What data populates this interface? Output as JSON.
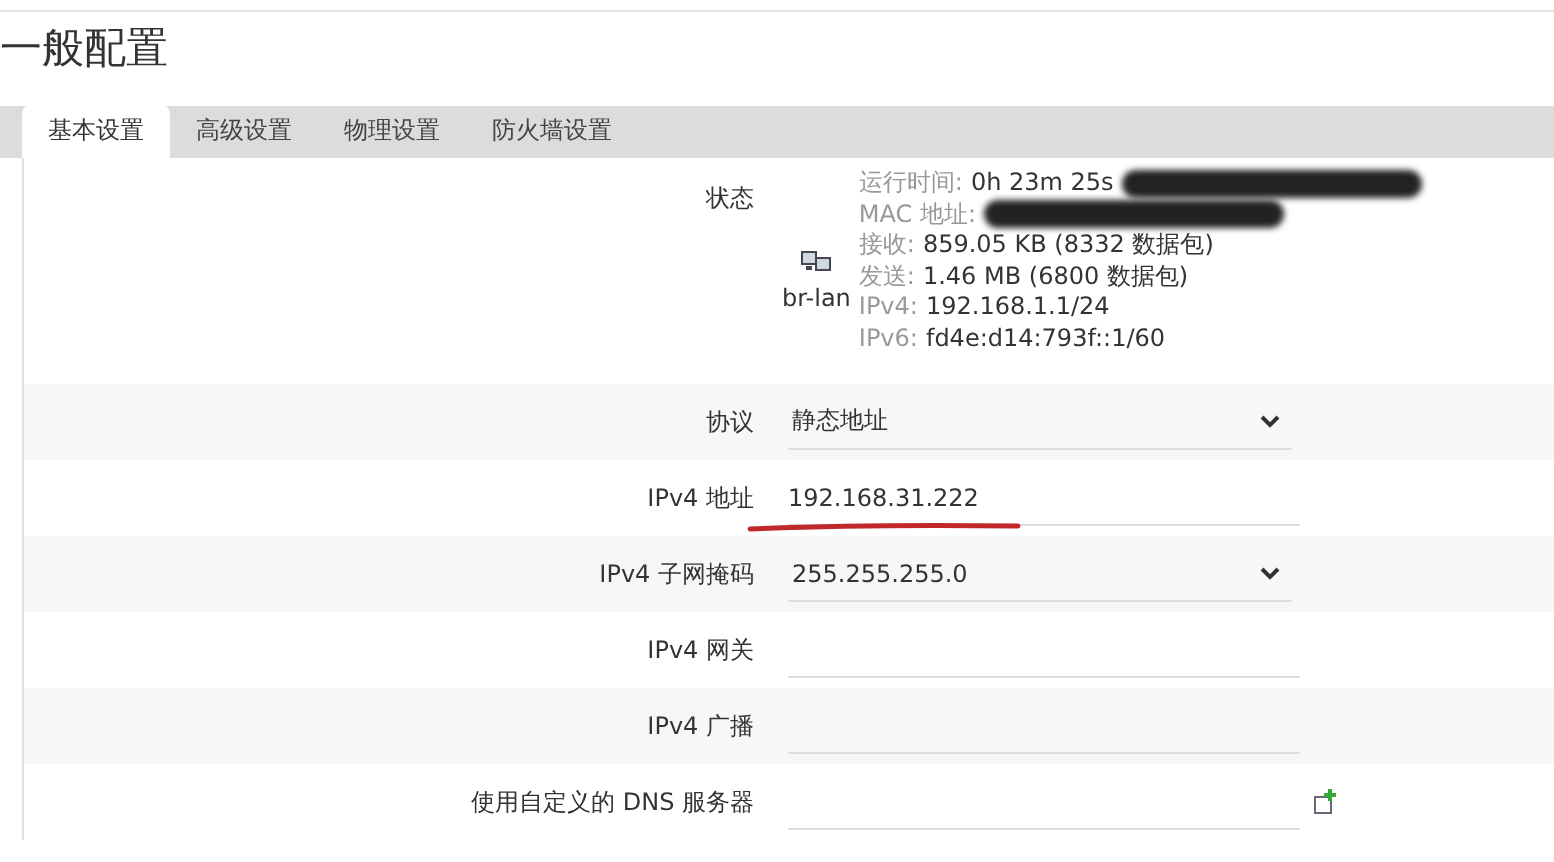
{
  "page_title": "一般配置",
  "tabs": [
    {
      "label": "基本设置",
      "selected": true
    },
    {
      "label": "高级设置",
      "selected": false
    },
    {
      "label": "物理设置",
      "selected": false
    },
    {
      "label": "防火墙设置",
      "selected": false
    }
  ],
  "status": {
    "label": "状态",
    "interface": "br-lan",
    "lines": [
      {
        "label": "运行时间:",
        "value": "0h 23m 25s",
        "redacted": true
      },
      {
        "label": "MAC 地址:",
        "redacted": true
      },
      {
        "label": "接收:",
        "value": "859.05 KB (8332 数据包)",
        "redacted": false
      },
      {
        "label": "发送:",
        "value": "1.46 MB (6800 数据包)",
        "redacted": false
      },
      {
        "label": "IPv4:",
        "value": "192.168.1.1/24",
        "redacted": false
      },
      {
        "label": "IPv6:",
        "value": "fd4e:d14:793f::1/60",
        "redacted": false
      }
    ]
  },
  "fields": [
    {
      "kind": "select",
      "label": "协议",
      "value": "静态地址",
      "underlined": false
    },
    {
      "kind": "text",
      "label": "IPv4 地址",
      "value": "192.168.31.222",
      "underlined": true
    },
    {
      "kind": "select",
      "label": "IPv4 子网掩码",
      "value": "255.255.255.0",
      "underlined": false
    },
    {
      "kind": "text",
      "label": "IPv4 网关",
      "underlined": false
    },
    {
      "kind": "text",
      "label": "IPv4 广播",
      "underlined": false
    },
    {
      "kind": "dynlist",
      "label": "使用自定义的 DNS 服务器",
      "underlined": false
    }
  ]
}
